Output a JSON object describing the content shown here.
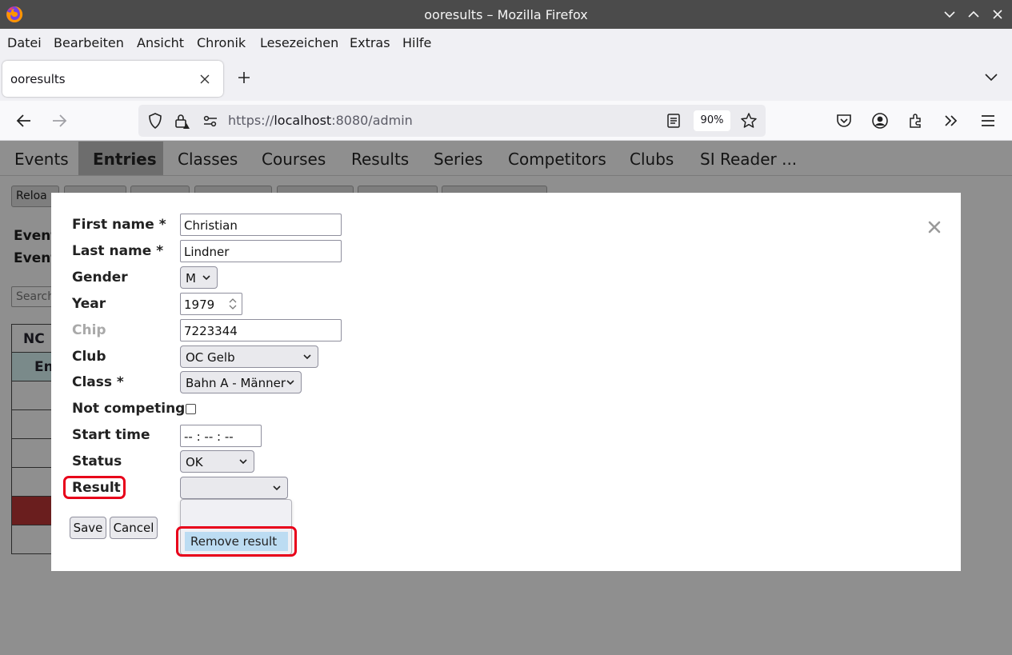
{
  "window": {
    "title": "ooresults – Mozilla Firefox"
  },
  "menubar": {
    "items": [
      "Datei",
      "Bearbeiten",
      "Ansicht",
      "Chronik",
      "Lesezeichen",
      "Extras",
      "Hilfe"
    ]
  },
  "tab": {
    "title": "ooresults"
  },
  "urlbar": {
    "scheme": "https://",
    "host": "localhost",
    "rest": ":8080/admin",
    "zoom": "90%"
  },
  "page_nav": {
    "items": [
      "Events",
      "Entries",
      "Classes",
      "Courses",
      "Results",
      "Series",
      "Competitors",
      "Clubs",
      "SI Reader ..."
    ],
    "active": "Entries"
  },
  "background": {
    "reload_button": "Reloa",
    "event_label_1": "Event",
    "event_label_2": "Event",
    "search_placeholder": "Search",
    "table_header": "NC",
    "table_row_label": "En"
  },
  "form": {
    "first_name_label": "First name *",
    "first_name_value": "Christian",
    "last_name_label": "Last name *",
    "last_name_value": "Lindner",
    "gender_label": "Gender",
    "gender_value": "M",
    "year_label": "Year",
    "year_value": "1979",
    "chip_label": "Chip",
    "chip_value": "7223344",
    "club_label": "Club",
    "club_value": "OC Gelb",
    "class_label": "Class *",
    "class_value": "Bahn A - Männer",
    "not_competing_label": "Not competing",
    "start_time_label": "Start time",
    "start_time_value": "-- : -- : --",
    "status_label": "Status",
    "status_value": "OK",
    "result_label": "Result",
    "result_value": "",
    "save_button": "Save",
    "cancel_button": "Cancel"
  },
  "result_dropdown": {
    "options": [
      "",
      "Remove result"
    ],
    "highlighted": "Remove result"
  },
  "colors": {
    "highlight_outline": "#e8001a",
    "option_highlight": "#bcdcf2",
    "overlay": "#8f8f8f"
  }
}
